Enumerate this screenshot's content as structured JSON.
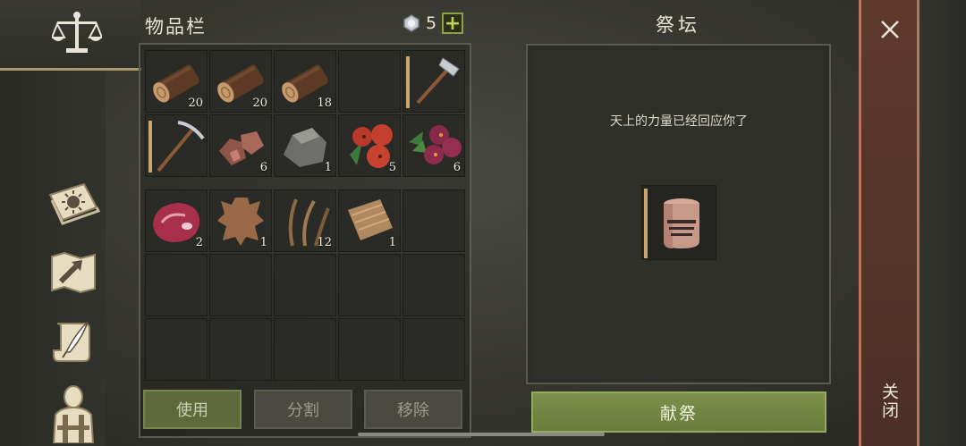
{
  "inventory": {
    "title": "物品栏",
    "gem_count": "5",
    "add_button": "+",
    "slots_row1": [
      {
        "item": "log",
        "qty": "20"
      },
      {
        "item": "log",
        "qty": "20"
      },
      {
        "item": "log",
        "qty": "18"
      },
      {
        "item": "empty",
        "qty": ""
      },
      {
        "item": "hammer",
        "qty": ""
      }
    ],
    "slots_row2": [
      {
        "item": "pickaxe",
        "qty": ""
      },
      {
        "item": "copper-ore",
        "qty": "6"
      },
      {
        "item": "stone",
        "qty": "1"
      },
      {
        "item": "red-berries",
        "qty": "5"
      },
      {
        "item": "purple-berries",
        "qty": "6"
      }
    ],
    "slots_row3": [
      {
        "item": "raw-meat",
        "qty": "2"
      },
      {
        "item": "leather-hide",
        "qty": "1"
      },
      {
        "item": "plant-fiber",
        "qty": "12"
      },
      {
        "item": "cloth",
        "qty": "1"
      },
      {
        "item": "empty",
        "qty": ""
      }
    ],
    "buttons": {
      "use": "使用",
      "split": "分割",
      "remove": "移除"
    }
  },
  "altar": {
    "title": "祭坛",
    "message": "天上的力量已经回应你了",
    "slot_item": "knight-helmet",
    "sacrifice_button": "献祭"
  },
  "close_panel": {
    "label": "关闭"
  },
  "sidebar": {
    "icons": [
      "scale-icon",
      "journal-sun-icon",
      "map-icon",
      "scroll-quill-icon",
      "character-icon"
    ]
  },
  "colors": {
    "accent_green": "#7d8f4a",
    "close_panel": "#5e3a2d",
    "plus_green": "#b9d05a"
  }
}
